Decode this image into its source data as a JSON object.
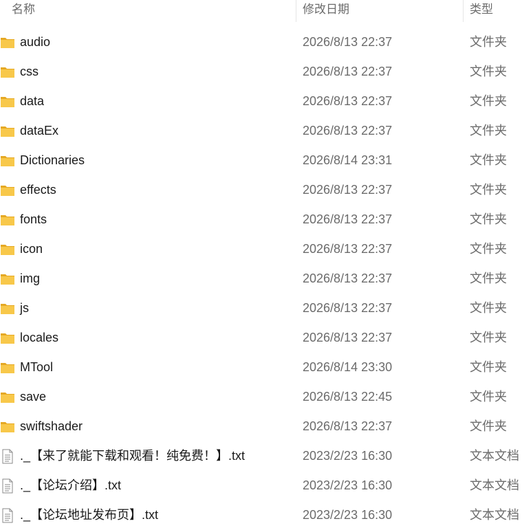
{
  "columns": {
    "name": "名称",
    "modified": "修改日期",
    "type": "类型"
  },
  "colors": {
    "folder": "#F8C84A",
    "folder_dark": "#E5A823",
    "header_text": "#6B6B6B",
    "separator": "#E5E5E5"
  },
  "rows": [
    {
      "name": "audio",
      "modified": "2026/8/13 22:37",
      "type": "文件夹",
      "icon": "folder-icon"
    },
    {
      "name": "css",
      "modified": "2026/8/13 22:37",
      "type": "文件夹",
      "icon": "folder-icon"
    },
    {
      "name": "data",
      "modified": "2026/8/13 22:37",
      "type": "文件夹",
      "icon": "folder-icon"
    },
    {
      "name": "dataEx",
      "modified": "2026/8/13 22:37",
      "type": "文件夹",
      "icon": "folder-icon"
    },
    {
      "name": "Dictionaries",
      "modified": "2026/8/14 23:31",
      "type": "文件夹",
      "icon": "folder-icon"
    },
    {
      "name": "effects",
      "modified": "2026/8/13 22:37",
      "type": "文件夹",
      "icon": "folder-icon"
    },
    {
      "name": "fonts",
      "modified": "2026/8/13 22:37",
      "type": "文件夹",
      "icon": "folder-icon"
    },
    {
      "name": "icon",
      "modified": "2026/8/13 22:37",
      "type": "文件夹",
      "icon": "folder-icon"
    },
    {
      "name": "img",
      "modified": "2026/8/13 22:37",
      "type": "文件夹",
      "icon": "folder-icon"
    },
    {
      "name": "js",
      "modified": "2026/8/13 22:37",
      "type": "文件夹",
      "icon": "folder-icon"
    },
    {
      "name": "locales",
      "modified": "2026/8/13 22:37",
      "type": "文件夹",
      "icon": "folder-icon"
    },
    {
      "name": "MTool",
      "modified": "2026/8/14 23:30",
      "type": "文件夹",
      "icon": "folder-icon"
    },
    {
      "name": "save",
      "modified": "2026/8/13 22:45",
      "type": "文件夹",
      "icon": "folder-icon"
    },
    {
      "name": "swiftshader",
      "modified": "2026/8/13 22:37",
      "type": "文件夹",
      "icon": "folder-icon"
    },
    {
      "name": "._【来了就能下载和观看！纯免费！】.txt",
      "modified": "2023/2/23 16:30",
      "type": "文本文档",
      "icon": "text-file-icon"
    },
    {
      "name": "._【论坛介绍】.txt",
      "modified": "2023/2/23 16:30",
      "type": "文本文档",
      "icon": "text-file-icon"
    },
    {
      "name": "._【论坛地址发布页】.txt",
      "modified": "2023/2/23 16:30",
      "type": "文本文档",
      "icon": "text-file-icon"
    }
  ]
}
